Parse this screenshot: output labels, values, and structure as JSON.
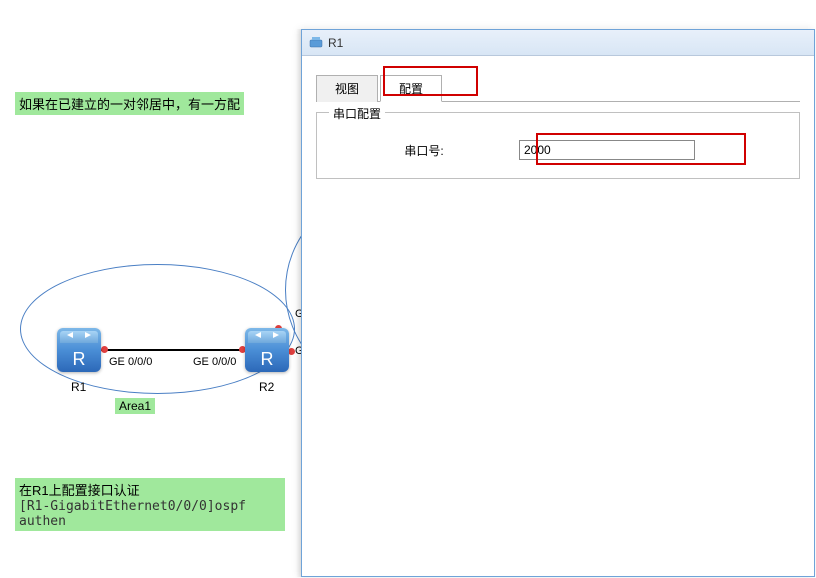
{
  "bg": {
    "text1": "如果在已建立的一对邻居中，有一方配",
    "text2": "在R1上配置接口认证",
    "text3": "[R1-GigabitEthernet0/0/0]ospf authen"
  },
  "diagram": {
    "r1_label": "R1",
    "r2_label": "R2",
    "port1": "GE 0/0/0",
    "port2": "GE 0/0/0",
    "port3": "G",
    "port4": "G",
    "area_label": "Area1"
  },
  "window": {
    "title": "R1",
    "tabs": {
      "view": "视图",
      "config": "配置"
    },
    "fieldset_legend": "串口配置",
    "field_label": "串口号:",
    "field_value": "2000"
  }
}
